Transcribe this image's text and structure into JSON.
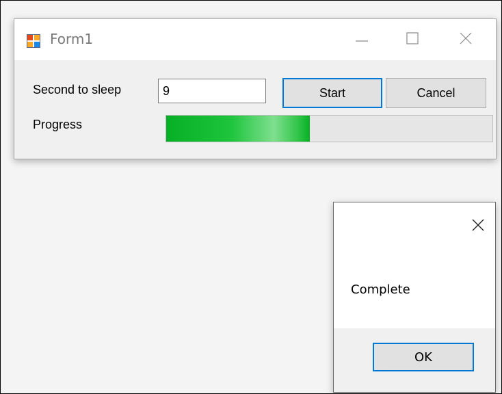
{
  "window": {
    "title": "Form1",
    "icons": {
      "app": "form-app-icon",
      "minimize": "minimize-icon",
      "maximize": "maximize-icon",
      "close": "close-icon"
    }
  },
  "form": {
    "seconds_label": "Second to sleep",
    "seconds_value": "9",
    "start_label": "Start",
    "cancel_label": "Cancel",
    "progress_label": "Progress",
    "progress_fraction": 0.44
  },
  "colors": {
    "progress_green": "#06b025",
    "focus_blue": "#0078d7"
  },
  "dialog": {
    "message": "Complete",
    "ok_label": "OK",
    "close_icon": "close-icon"
  }
}
